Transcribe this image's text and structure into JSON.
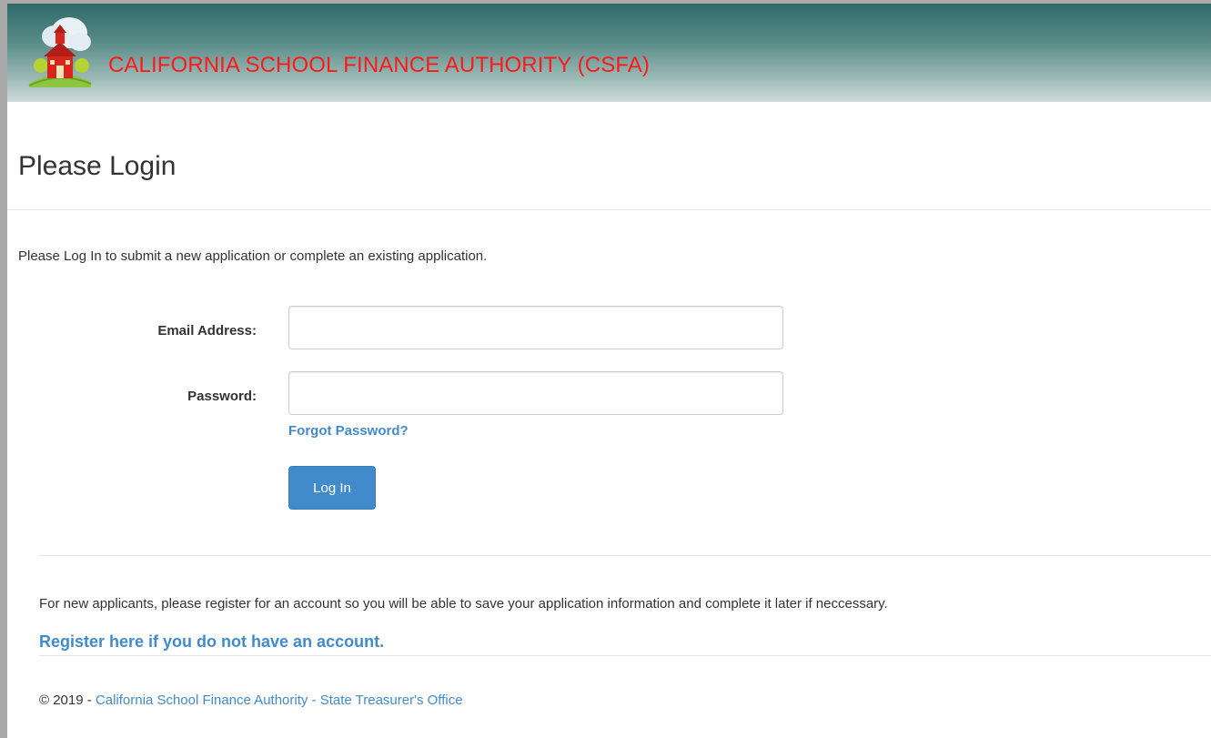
{
  "header": {
    "brand_title": "CALIFORNIA SCHOOL FINANCE AUTHORITY (CSFA)",
    "logo_icon": "schoolhouse-logo-icon",
    "brand_color": "#ff1a1a",
    "gradient_top": "#2e6a68",
    "gradient_bottom": "#cfdcdb"
  },
  "main": {
    "title": "Please Login",
    "intro": "Please Log In to submit a new application or complete an existing application."
  },
  "form": {
    "email_label": "Email Address:",
    "email_value": "",
    "email_placeholder": "",
    "password_label": "Password:",
    "password_value": "",
    "password_placeholder": "",
    "forgot_link": "Forgot Password?",
    "login_button": "Log In",
    "button_color": "#428bca",
    "link_color": "#428bca"
  },
  "register": {
    "note": "For new applicants, please register for an account so you will be able to save your application information and complete it later if neccessary.",
    "link": "Register here if you do not have an account."
  },
  "footer": {
    "copyright": "© 2019 - ",
    "link": "California School Finance Authority - State Treasurer's Office"
  }
}
